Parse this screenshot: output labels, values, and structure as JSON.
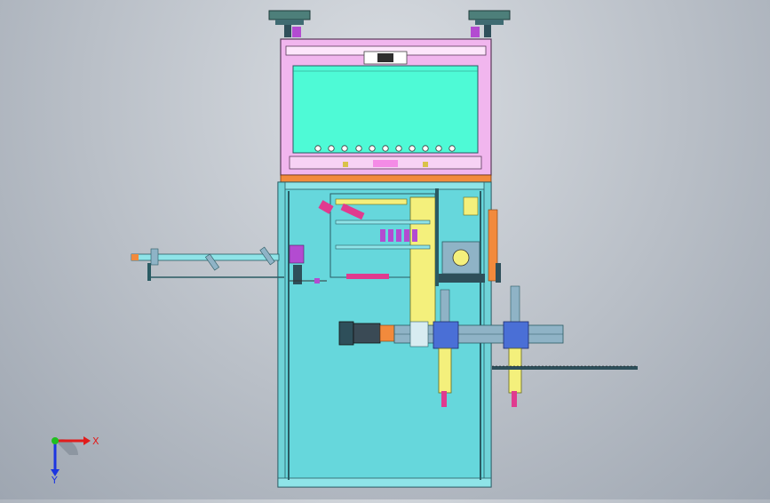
{
  "viewport": {
    "background_top": "#d9dde2",
    "background_bottom": "#9ea6b1",
    "model_colors": {
      "frame": "#6fd3d8",
      "frame_edge": "#2a5b63",
      "enclosure_pink": "#f1b6ee",
      "panel_mint": "#4efad6",
      "interior_cyan": "#66d7dc",
      "plate_yellow": "#f4f07c",
      "orange_band": "#f28a3c",
      "actuator_steel": "#8fb3c6",
      "motor_dark": "#3a4a55"
    }
  },
  "triad": {
    "x_label": "X",
    "y_label": "Y",
    "x_color": "#e11c1c",
    "y_color": "#1c35e1",
    "origin_color": "#1fbf1f",
    "icon": "coordinate-triad-icon"
  }
}
